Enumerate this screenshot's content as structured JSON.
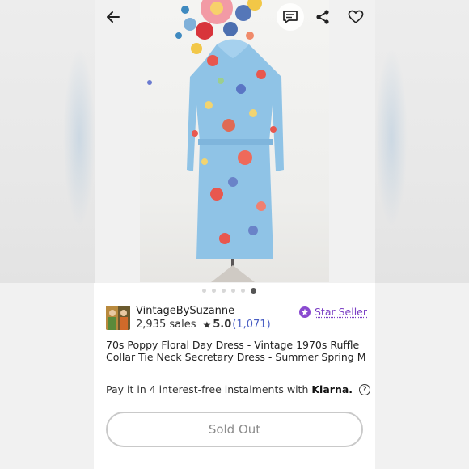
{
  "seller": {
    "name": "VintageBySuzanne",
    "sales": "2,935 sales",
    "star_glyph": "★",
    "rating": "5.0",
    "review_count": "(1,071)",
    "badge_label": "Star Seller"
  },
  "listing": {
    "title_line1": "70s Poppy Floral Day Dress - Vintage 1970s Ruffle",
    "title_line2": "Collar Tie Neck Secretary Dress - Summer Spring Mo..."
  },
  "payment": {
    "text": "Pay it in 4 interest-free instalments with",
    "brand": "Klarna.",
    "help": "?"
  },
  "actions": {
    "sold_out_label": "Sold Out"
  },
  "carousel": {
    "total": 6,
    "active_index": 5
  },
  "icons": {
    "back": "arrow-left",
    "message": "message",
    "share": "share",
    "favorite": "heart"
  },
  "colors": {
    "accent_star_seller": "#7b3fc4",
    "link": "#4a5fc4",
    "dress": "#8fc3e6"
  }
}
